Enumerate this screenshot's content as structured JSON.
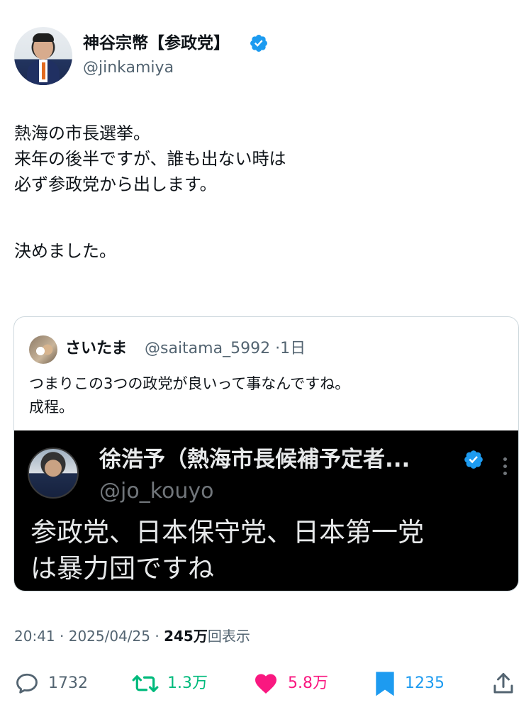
{
  "author": {
    "display_name": "神谷宗幣【参政党】",
    "handle": "@jinkamiya",
    "verified": true
  },
  "tweet": {
    "lines": [
      "熱海の市長選挙。",
      "来年の後半ですが、誰も出ない時は",
      "必ず参政党から出します。",
      "",
      "決めました。"
    ]
  },
  "quote": {
    "name": "さいたま",
    "handle": "@saitama_5992",
    "time_sep": "·",
    "time": "1日",
    "text_lines": [
      "つまりこの3つの政党が良いって事なんですね。",
      "成程。"
    ],
    "embedded_image": {
      "name": "徐浩予（熱海市長候補予定者...",
      "handle": "@jo_kouyo",
      "text_lines": [
        "参政党、日本保守党、日本第一党",
        "は暴力団ですね"
      ]
    }
  },
  "meta": {
    "time": "20:41",
    "date": "2025/04/25",
    "sep": "·",
    "views_count": "245",
    "views_unit": "万",
    "views_label": "回表示"
  },
  "actions": {
    "replies": "1732",
    "retweets": "1.3万",
    "likes": "5.8万",
    "bookmarks": "1235"
  },
  "colors": {
    "verified": "#1d9bf0",
    "retweet": "#00ba7c",
    "like": "#f91880",
    "bookmark": "#1d9bf0",
    "secondary_text": "#536471"
  },
  "icons": [
    "verified-badge-icon",
    "reply-icon",
    "retweet-icon",
    "heart-icon",
    "bookmark-icon",
    "share-icon",
    "more-icon"
  ]
}
